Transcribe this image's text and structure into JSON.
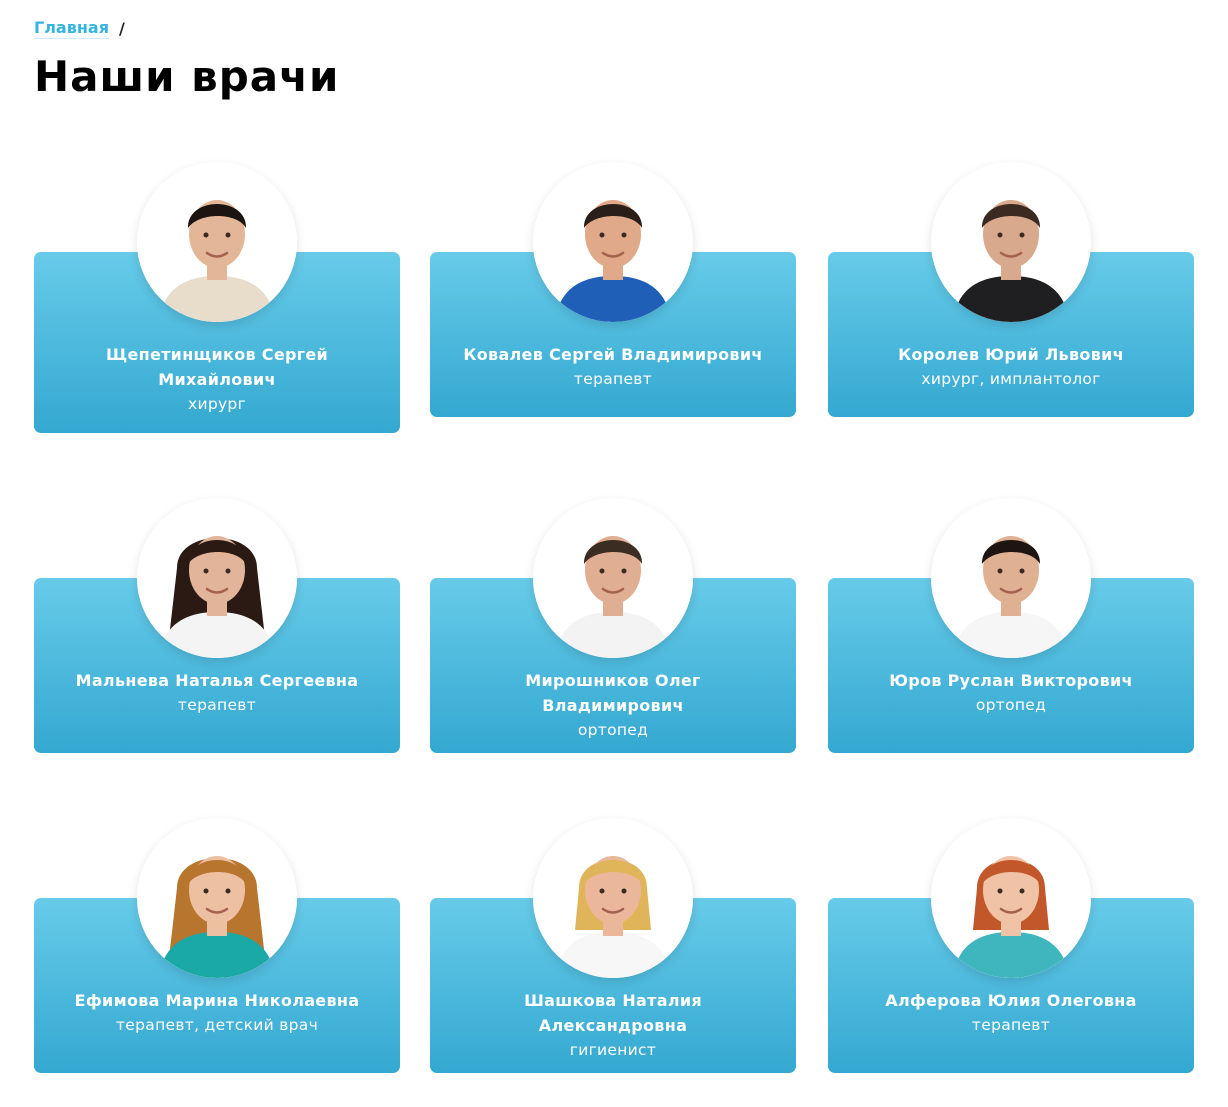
{
  "breadcrumb": {
    "home": "Главная",
    "separator": "/"
  },
  "page": {
    "title": "Наши врачи"
  },
  "doctors": [
    {
      "name": "Щепетинщиков Сергей Михайлович",
      "role": "хирург",
      "photo": {
        "hair": "#1b1410",
        "skin": "#e3b697",
        "clothes": "#e8dccb",
        "hair_style": "short"
      }
    },
    {
      "name": "Ковалев Сергей Владимирович",
      "role": "терапевт",
      "photo": {
        "hair": "#2a1e18",
        "skin": "#dfa98a",
        "clothes": "#1f5fb8",
        "hair_style": "short"
      }
    },
    {
      "name": "Королев Юрий Львович",
      "role": "хирург, имплантолог",
      "photo": {
        "hair": "#3a2a22",
        "skin": "#d9a98d",
        "clothes": "#1f1f22",
        "hair_style": "short"
      }
    },
    {
      "name": "Мальнева Наталья Сергеевна",
      "role": "терапевт",
      "photo": {
        "hair": "#2b1a14",
        "skin": "#e2b49a",
        "clothes": "#f4f4f4",
        "hair_style": "long"
      }
    },
    {
      "name": "Мирошников Олег Владимирович",
      "role": "ортопед",
      "photo": {
        "hair": "#3b2d22",
        "skin": "#e0ae92",
        "clothes": "#f3f3f3",
        "hair_style": "short"
      }
    },
    {
      "name": "Юров Руслан Викторович",
      "role": "ортопед",
      "photo": {
        "hair": "#1c1512",
        "skin": "#e0b093",
        "clothes": "#f6f6f6",
        "hair_style": "short"
      }
    },
    {
      "name": "Ефимова Марина Николаевна",
      "role": "терапевт, детский врач",
      "photo": {
        "hair": "#b8752e",
        "skin": "#eec0a2",
        "clothes": "#1aa9a4",
        "hair_style": "long"
      }
    },
    {
      "name": "Шашкова Наталия Александровна",
      "role": "гигиенист",
      "photo": {
        "hair": "#e0b55a",
        "skin": "#eab79a",
        "clothes": "#f7f7f7",
        "hair_style": "medium"
      }
    },
    {
      "name": "Алферова Юлия Олеговна",
      "role": "терапевт",
      "photo": {
        "hair": "#c2572a",
        "skin": "#f0c2a6",
        "clothes": "#3fb6bd",
        "hair_style": "medium"
      }
    }
  ]
}
